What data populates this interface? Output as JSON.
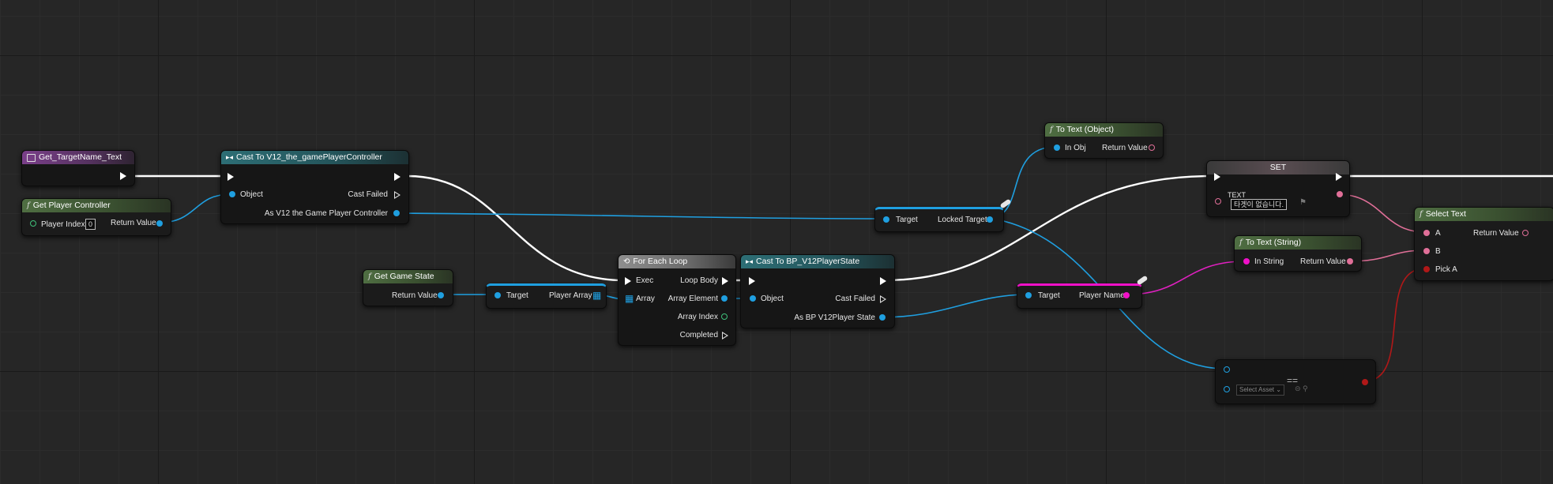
{
  "nodes": {
    "event": {
      "title": "Get_TargetName_Text"
    },
    "get_player_controller": {
      "title": "Get Player Controller",
      "player_index_label": "Player Index",
      "player_index_value": "0",
      "return_value": "Return Value"
    },
    "cast_controller": {
      "title": "Cast To V12_the_gamePlayerController",
      "object": "Object",
      "cast_failed": "Cast Failed",
      "as_output": "As V12 the Game Player Controller"
    },
    "get_game_state": {
      "title": "Get Game State",
      "return_value": "Return Value"
    },
    "player_array": {
      "target": "Target",
      "output": "Player Array"
    },
    "for_each": {
      "title": "For Each Loop",
      "exec": "Exec",
      "array": "Array",
      "loop_body": "Loop Body",
      "array_element": "Array Element",
      "array_index": "Array Index",
      "completed": "Completed"
    },
    "cast_state": {
      "title": "Cast To BP_V12PlayerState",
      "object": "Object",
      "cast_failed": "Cast Failed",
      "as_output": "As BP V12Player State"
    },
    "locked_target": {
      "target": "Target",
      "output": "Locked Target"
    },
    "to_text_object": {
      "title": "To Text (Object)",
      "in_obj": "In Obj",
      "return_value": "Return Value"
    },
    "player_name": {
      "target": "Target",
      "output": "Player Name"
    },
    "to_text_string": {
      "title": "To Text (String)",
      "in_string": "In String",
      "return_value": "Return Value"
    },
    "set_node": {
      "title": "SET",
      "var_label": "TEXT",
      "var_value": "타겟이 없습니다."
    },
    "select_text": {
      "title": "Select Text",
      "a": "A",
      "b": "B",
      "pick_a": "Pick A",
      "return_value": "Return Value"
    },
    "select_asset": {
      "placeholder": "Select Asset"
    }
  },
  "colors": {
    "exec_wire": "#ffffff",
    "object_wire": "#1f9fe0",
    "string_wire": "#e020c0",
    "text_wire": "#e06f98",
    "bool_wire": "#b01818",
    "function_header": "#4f6e42",
    "cast_header": "#2d6e75",
    "event_header": "#7a3f8a"
  }
}
